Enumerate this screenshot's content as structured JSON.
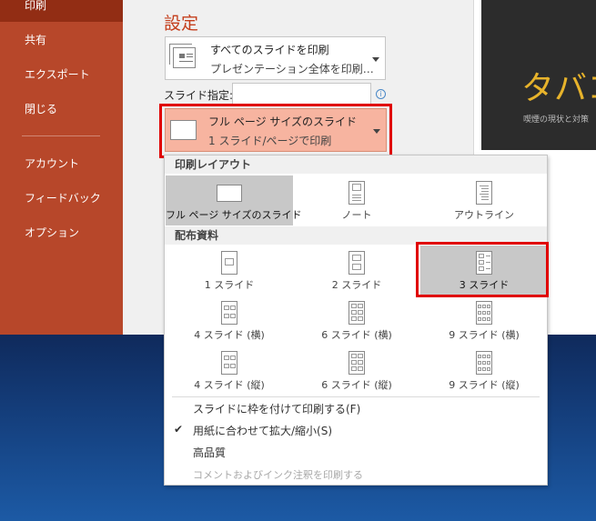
{
  "sidebar": {
    "items": [
      {
        "label": "印刷"
      },
      {
        "label": "共有"
      },
      {
        "label": "エクスポート"
      },
      {
        "label": "閉じる"
      },
      {
        "label": "アカウント"
      },
      {
        "label": "フィードバック"
      },
      {
        "label": "オプション"
      }
    ]
  },
  "settings": {
    "heading": "設定",
    "print_range": {
      "line1": "すべてのスライドを印刷",
      "line2": "プレゼンテーション全体を印刷…"
    },
    "slides_label": "スライド指定:",
    "slides_value": "",
    "layout": {
      "line1": "フル ページ サイズのスライド",
      "line2": "1 スライド/ページで印刷"
    }
  },
  "preview": {
    "title": "タバコ",
    "subtitle": "喫煙の現状と対策"
  },
  "dropdown": {
    "print_layout_heading": "印刷レイアウト",
    "print_layout": [
      {
        "label": "フル ページ サイズのスライド"
      },
      {
        "label": "ノート"
      },
      {
        "label": "アウトライン"
      }
    ],
    "handouts_heading": "配布資料",
    "handouts": [
      {
        "label": "1 スライド"
      },
      {
        "label": "2 スライド"
      },
      {
        "label": "3 スライド"
      },
      {
        "label": "4 スライド (横)"
      },
      {
        "label": "6 スライド (横)"
      },
      {
        "label": "9 スライド (横)"
      },
      {
        "label": "4 スライド (縦)"
      },
      {
        "label": "6 スライド (縦)"
      },
      {
        "label": "9 スライド (縦)"
      }
    ],
    "options": [
      {
        "label": "スライドに枠を付けて印刷する(F)"
      },
      {
        "label": "用紙に合わせて拡大/縮小(S)"
      },
      {
        "label": "高品質"
      },
      {
        "label": "コメントおよびインク注釈を印刷する"
      }
    ],
    "checkmark": "✔"
  },
  "colors": {
    "accent": "#b7472a",
    "highlight": "#e00000"
  }
}
